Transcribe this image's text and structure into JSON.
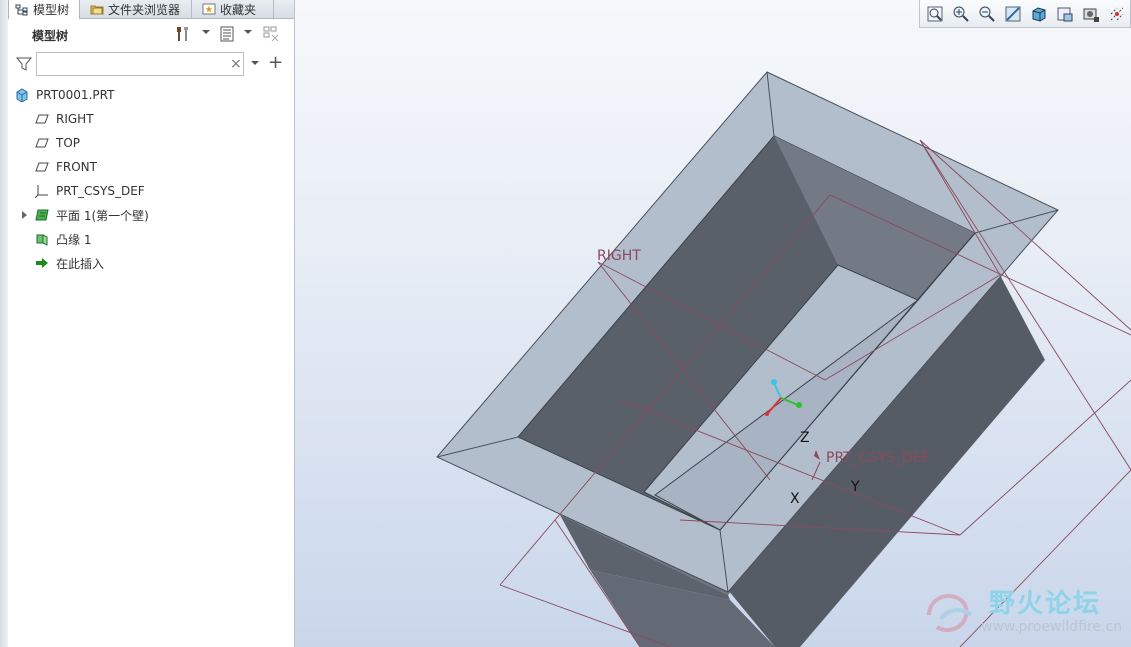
{
  "tabs": [
    {
      "label": "模型树",
      "icon": "model-tree-icon"
    },
    {
      "label": "文件夹浏览器",
      "icon": "folder-browser-icon"
    },
    {
      "label": "收藏夹",
      "icon": "favorites-icon"
    }
  ],
  "panel": {
    "title": "模型树",
    "search_value": "",
    "search_placeholder": "",
    "clear_symbol": "×",
    "add_symbol": "+"
  },
  "tree": {
    "items": [
      {
        "label": "PRT0001.PRT",
        "icon": "part-icon",
        "indent": 0,
        "expandable": false
      },
      {
        "label": "RIGHT",
        "icon": "datum-plane-icon",
        "indent": 1,
        "expandable": false
      },
      {
        "label": "TOP",
        "icon": "datum-plane-icon",
        "indent": 1,
        "expandable": false
      },
      {
        "label": "FRONT",
        "icon": "datum-plane-icon",
        "indent": 1,
        "expandable": false
      },
      {
        "label": "PRT_CSYS_DEF",
        "icon": "csys-icon",
        "indent": 1,
        "expandable": false
      },
      {
        "label": "平面 1(第一个壁)",
        "icon": "sheetmetal-wall-icon",
        "indent": 1,
        "expandable": true
      },
      {
        "label": "凸缘 1",
        "icon": "flange-icon",
        "indent": 1,
        "expandable": false
      },
      {
        "label": "在此插入",
        "icon": "insert-here-icon",
        "indent": 1,
        "expandable": false
      }
    ]
  },
  "viewport": {
    "datum_labels": {
      "right": "RIGHT",
      "csys": "PRT_CSYS_DEF"
    },
    "axis_labels": {
      "x": "X",
      "y": "Y",
      "z": "Z"
    },
    "toolbar_icons": [
      "refit-icon",
      "zoom-in-icon",
      "zoom-out-icon",
      "repaint-icon",
      "display-style-icon",
      "saved-views-icon",
      "view-manager-icon",
      "datum-display-icon"
    ]
  },
  "watermark": {
    "title": "野火论坛",
    "url": "www.proewildfire.cn"
  },
  "colors": {
    "accent_datum": "#8a4a5c",
    "surface_light": "#b4bfcd",
    "surface_dark": "#5b616c",
    "insert_arrow": "#1d8a1d"
  }
}
